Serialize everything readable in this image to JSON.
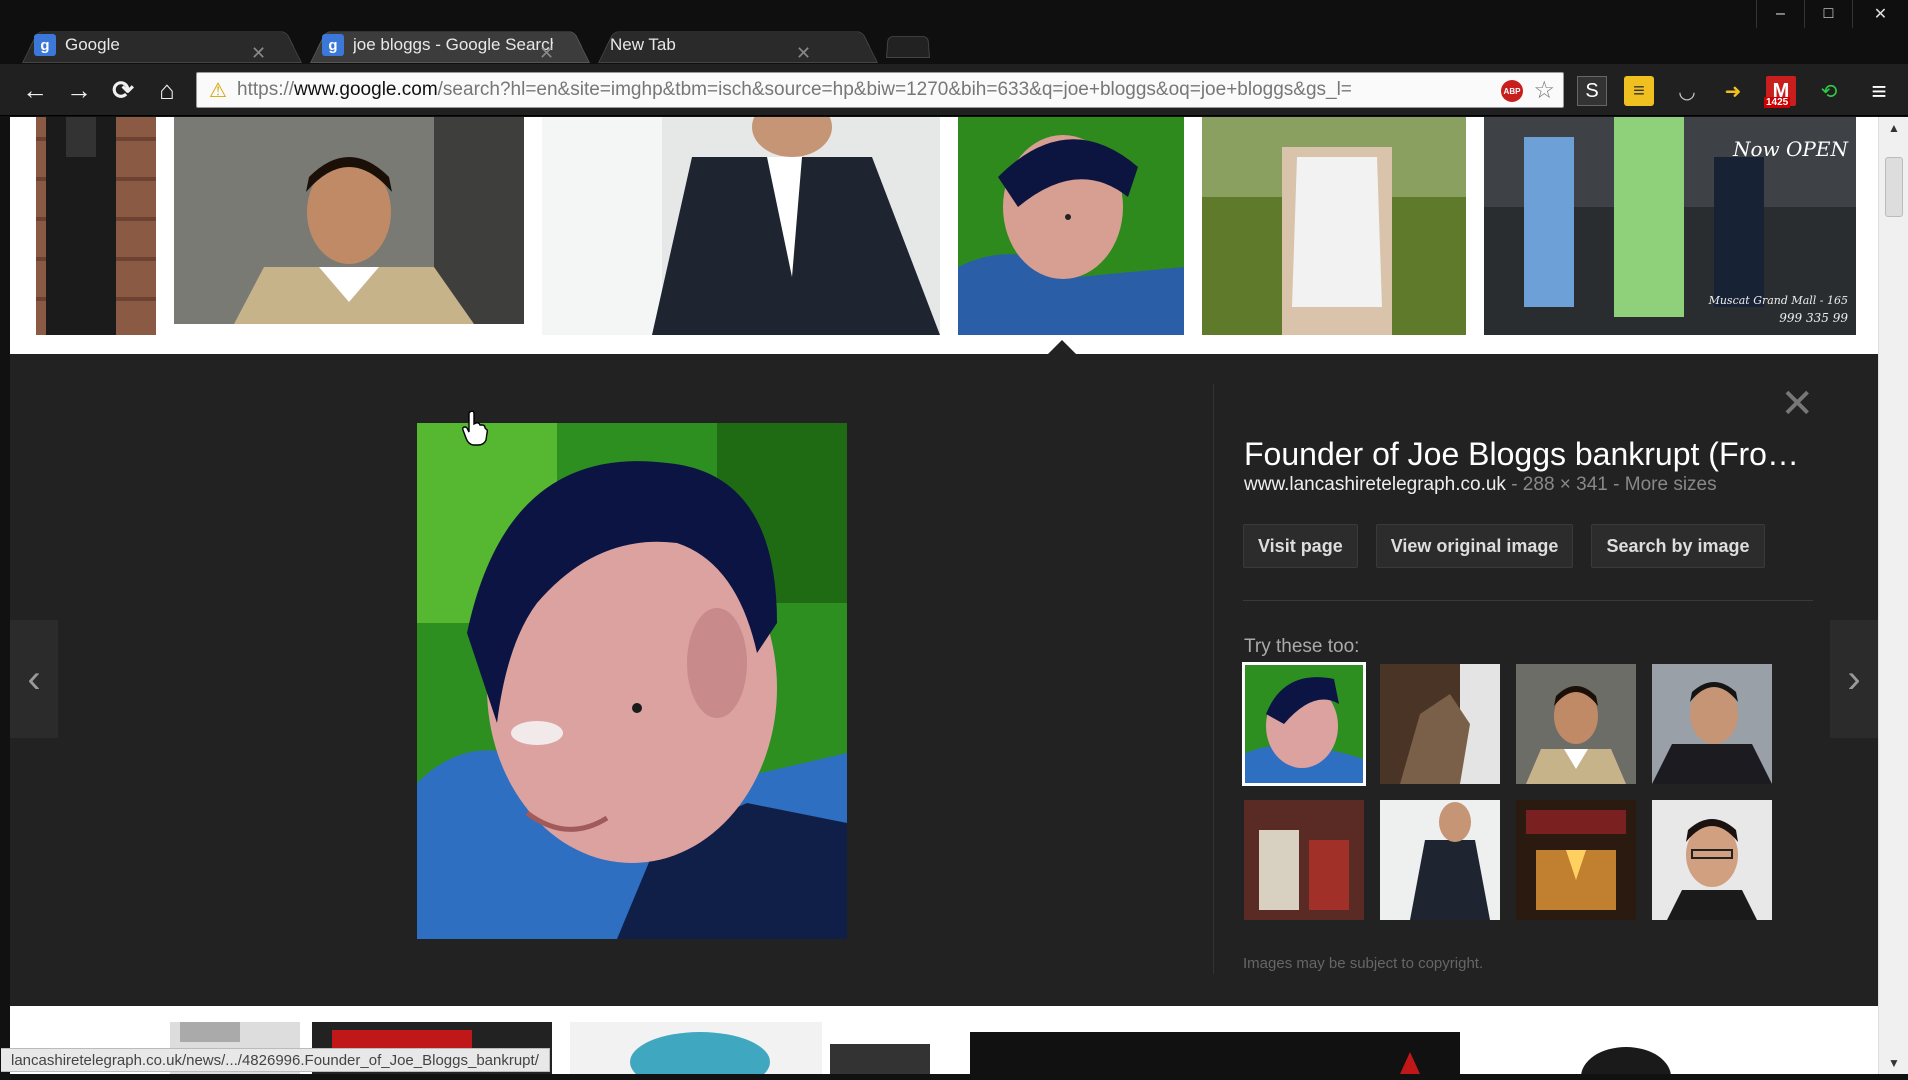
{
  "tabs": [
    {
      "label": "Google",
      "favicon": "g"
    },
    {
      "label": "joe bloggs - Google Search",
      "favicon": "g",
      "active": true
    },
    {
      "label": "New Tab"
    }
  ],
  "window_controls": {
    "minimize": "–",
    "maximize": "□",
    "close": "✕"
  },
  "nav": {
    "back": "←",
    "forward": "→",
    "reload": "⟳",
    "home": "⌂"
  },
  "address": {
    "scheme": "https://",
    "host": "www.google.com",
    "path": "/search?hl=en&site=imghp&tbm=isch&source=hp&biw=1270&bih=633&q=joe+bloggs&oq=joe+bloggs&gs_l="
  },
  "extensions": {
    "abp_label": "ABP",
    "gmail_count": "1425"
  },
  "detail": {
    "title": "Founder of Joe Bloggs bankrupt (Fro…",
    "domain": "www.lancashiretelegraph.co.uk",
    "dimensions": " - 288 × 341 - ",
    "more_sizes": "More sizes",
    "buttons": {
      "visit": "Visit page",
      "view_original": "View original image",
      "search_by_image": "Search by image"
    },
    "try_label": "Try these too:",
    "copyright": "Images may be subject to copyright."
  },
  "thumb_overlay": {
    "line1": "Now OPEN",
    "line2": "Muscat Grand Mall - 165",
    "line3": "999 335 99"
  },
  "status_url": "lancashiretelegraph.co.uk/news/.../4826996.Founder_of_Joe_Bloggs_bankrupt/",
  "colors": {
    "panel_bg": "#222222",
    "page_bg": "#ffffff",
    "chrome_bg": "#0f0f0f",
    "toolbar_bg": "#202020"
  }
}
